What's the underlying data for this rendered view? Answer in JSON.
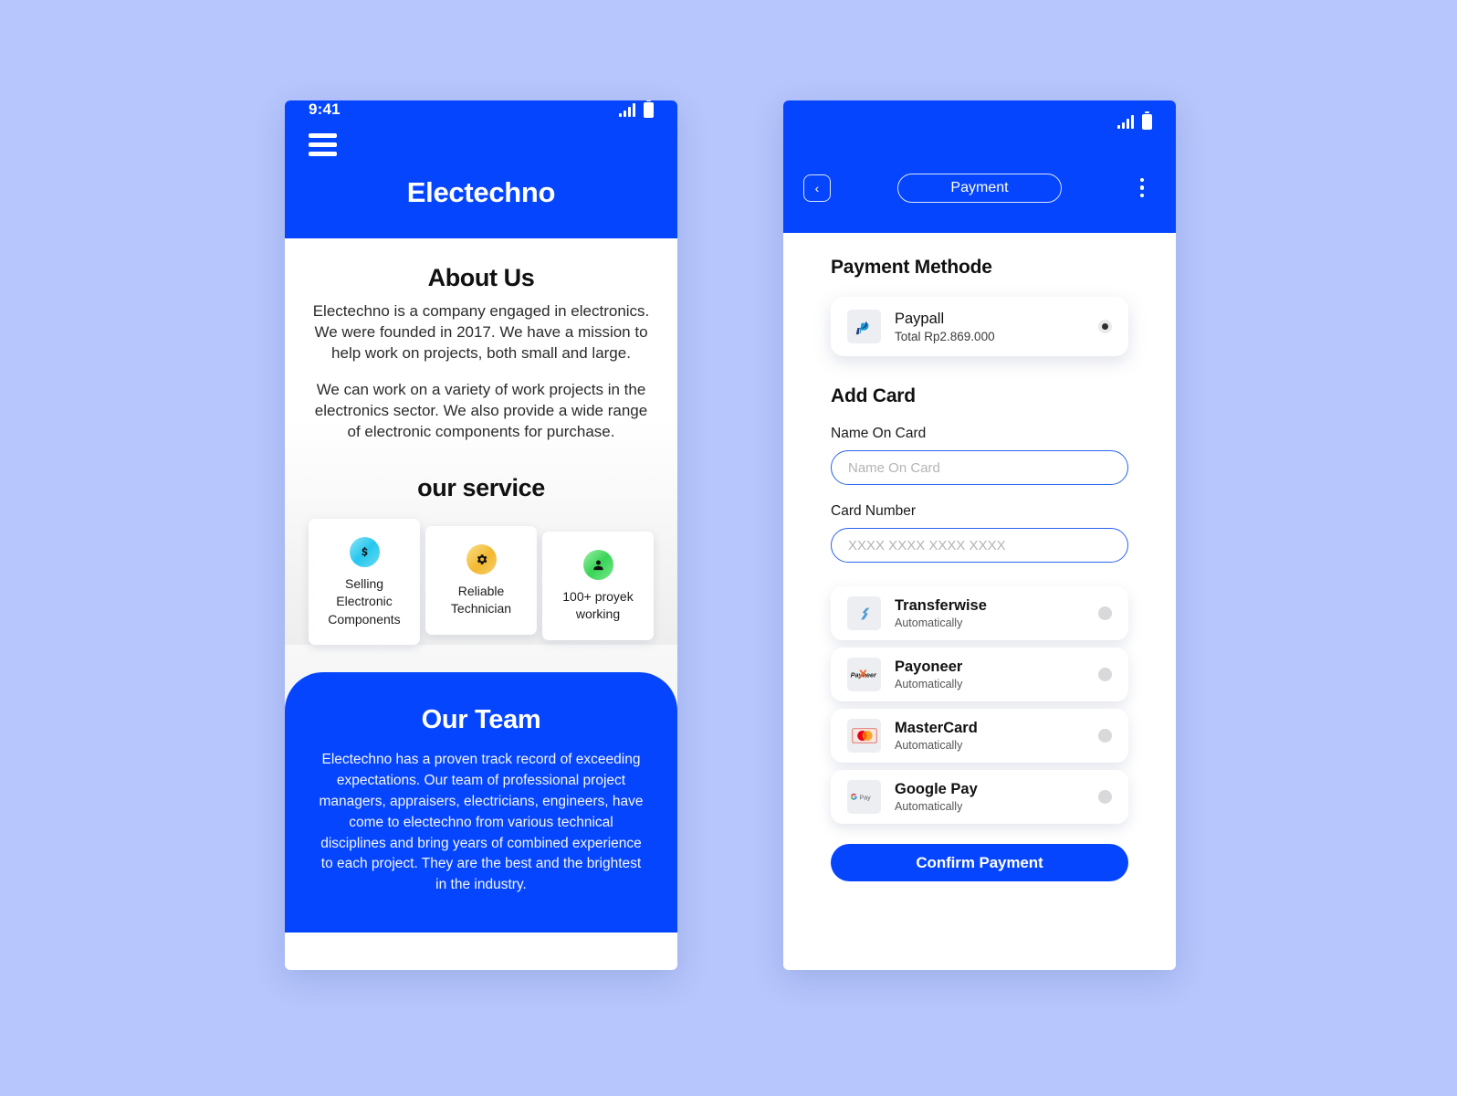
{
  "theme": {
    "brand_blue": "#0545FE",
    "page_bg": "#B7C6FC",
    "field_border": "#2B63F0"
  },
  "left_phone": {
    "status": {
      "time": "9:41",
      "signal_icon": "signal-bars-icon",
      "battery_icon": "battery-icon"
    },
    "menu_icon": "hamburger-menu-icon",
    "brand": "Electechno",
    "about": {
      "title": "About Us",
      "paragraph1": "Electechno is a company engaged in electronics. We were founded in 2017. We have a mission to help work on projects, both small and large.",
      "paragraph2": "We can work on a variety of work projects in the electronics sector. We also provide a wide range of electronic components for purchase."
    },
    "service": {
      "title": "our service",
      "cards": [
        {
          "icon": "dollar-sign-icon",
          "label": "Selling Electronic Components"
        },
        {
          "icon": "gear-icon",
          "label": "Reliable Technician"
        },
        {
          "icon": "person-icon",
          "label": "100+ proyek working"
        }
      ]
    },
    "team": {
      "title": "Our Team",
      "paragraph": "Electechno has a proven track record of exceeding expectations. Our team of professional project managers, appraisers, electricians, engineers, have come to electechno from various technical disciplines and bring years of combined experience to each project. They are the best and the brightest in the industry."
    }
  },
  "right_phone": {
    "status": {
      "signal_icon": "signal-bars-icon",
      "battery_icon": "battery-icon"
    },
    "header": {
      "back_icon": "chevron-left-icon",
      "title": "Payment",
      "menu_icon": "kebab-menu-icon"
    },
    "payment_method": {
      "heading": "Payment Methode",
      "selected": {
        "logo": "paypal-icon",
        "name": "Paypall",
        "sub": "Total Rp2.869.000",
        "selected": true
      }
    },
    "add_card": {
      "heading": "Add Card",
      "name_label": "Name On Card",
      "name_placeholder": "Name On Card",
      "name_value": "",
      "number_label": "Card Number",
      "number_placeholder": "XXXX XXXX XXXX XXXX",
      "number_value": ""
    },
    "providers": [
      {
        "logo": "transferwise-icon",
        "name": "Transferwise",
        "sub": "Automatically",
        "selected": false
      },
      {
        "logo": "payoneer-icon",
        "name": "Payoneer",
        "sub": "Automatically",
        "selected": false
      },
      {
        "logo": "mastercard-icon",
        "name": "MasterCard",
        "sub": "Automatically",
        "selected": false
      },
      {
        "logo": "googlepay-icon",
        "name": "Google Pay",
        "sub": "Automatically",
        "selected": false
      }
    ],
    "confirm_label": "Confirm Payment"
  }
}
